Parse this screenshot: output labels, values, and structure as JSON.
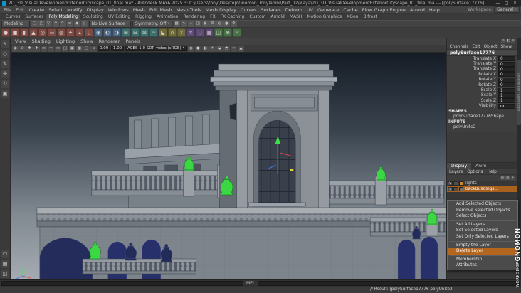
{
  "colors": {
    "manipulator_green": "#3fe04a",
    "axis_red": "#e04545",
    "axis_blue": "#4575e0",
    "handle_yellow": "#e8d43a",
    "urn_green": "#3bd843",
    "urn_navy": "#232b58",
    "selection_orange": "#a8611f"
  },
  "title_bar": {
    "title": "2D_3D_VisualDevelopmentExteriorCityscape_01_final.ma* - Autodesk MAYA 2025.3: C:\\Users\\tony\\Desktop\\Gnomon_TonyIanini\\Part_02\\Maya\\2D_3D_VisualDevelopmentExteriorCityscape_01_final.ma --- [polySurface17776]",
    "window_controls": {
      "minimize": "—",
      "maximize": "□",
      "close": "×"
    }
  },
  "menu_bar": {
    "items": [
      "File",
      "Edit",
      "Create",
      "Select",
      "Modify",
      "Display",
      "Windows",
      "Mesh",
      "Edit Mesh",
      "Mesh Tools",
      "Mesh Display",
      "Curves",
      "Surfaces",
      "Deform",
      "UV",
      "Generate",
      "Cache",
      "Flow Graph Engine",
      "Arnold",
      "Help"
    ],
    "workspace_label": "Workspace:",
    "workspace_value": "General"
  },
  "shelf": {
    "tabs": [
      {
        "label": "Curves"
      },
      {
        "label": "Surfaces"
      },
      {
        "label": "Poly Modeling",
        "active": true
      },
      {
        "label": "Sculpting"
      },
      {
        "label": "UV Editing"
      },
      {
        "label": "Rigging"
      },
      {
        "label": "Animation"
      },
      {
        "label": "Rendering"
      },
      {
        "label": "FX"
      },
      {
        "label": "FX Caching"
      },
      {
        "label": "Custom"
      },
      {
        "label": "Arnold"
      },
      {
        "label": "MASH"
      },
      {
        "label": "Motion Graphics"
      },
      {
        "label": "XGen"
      },
      {
        "label": "Bifrost"
      }
    ],
    "icons": [
      {
        "name": "poly-sphere-icon",
        "color": "#7b4a42",
        "glyph": "●"
      },
      {
        "name": "poly-cube-icon",
        "color": "#7b4a42",
        "glyph": "■"
      },
      {
        "name": "poly-cylinder-icon",
        "color": "#7b4a42",
        "glyph": "▮"
      },
      {
        "name": "poly-cone-icon",
        "color": "#7b4a42",
        "glyph": "▲"
      },
      {
        "name": "poly-torus-icon",
        "color": "#7b4a42",
        "glyph": "◎"
      },
      {
        "name": "poly-plane-icon",
        "color": "#7b4a42",
        "glyph": "▭"
      },
      {
        "name": "poly-disc-icon",
        "color": "#7b4a42",
        "glyph": "◍"
      },
      {
        "name": "poly-platonic-icon",
        "color": "#7b4a42",
        "glyph": "✦"
      },
      {
        "name": "poly-pyramid-icon",
        "color": "#7b4a42",
        "glyph": "▴"
      },
      {
        "name": "poly-pipe-icon",
        "color": "#7b4a42",
        "glyph": "▯"
      },
      {
        "name": "boolean-union-icon",
        "color": "#49627e",
        "glyph": "◉"
      },
      {
        "name": "boolean-difference-icon",
        "color": "#49627e",
        "glyph": "◐"
      },
      {
        "name": "boolean-intersect-icon",
        "color": "#49627e",
        "glyph": "◑"
      },
      {
        "name": "combine-icon",
        "color": "#3f6f6d",
        "glyph": "⊞"
      },
      {
        "name": "separate-icon",
        "color": "#3f6f6d",
        "glyph": "⊟"
      },
      {
        "name": "extract-icon",
        "color": "#3f6f6d",
        "glyph": "⊠"
      },
      {
        "name": "smooth-icon",
        "color": "#3f6f6d",
        "glyph": "≈"
      },
      {
        "name": "bevel-icon",
        "color": "#6e6a3c",
        "glyph": "◣"
      },
      {
        "name": "bridge-icon",
        "color": "#6e6a3c",
        "glyph": "∩"
      },
      {
        "name": "extrude-icon",
        "color": "#6e6a3c",
        "glyph": "⇧"
      },
      {
        "name": "multi-cut-icon",
        "color": "#5d4a73",
        "glyph": "✕"
      },
      {
        "name": "target-weld-icon",
        "color": "#5d4a73",
        "glyph": "◌"
      },
      {
        "name": "quad-draw-icon",
        "color": "#5d4a73",
        "glyph": "▦"
      },
      {
        "name": "mirror-icon",
        "color": "#4a7048",
        "glyph": "◫"
      },
      {
        "name": "merge-icon",
        "color": "#4a7048",
        "glyph": "⊕"
      },
      {
        "name": "connect-icon",
        "color": "#4a7048",
        "glyph": "≍"
      }
    ]
  },
  "status_line": {
    "menu_set": "Modeling",
    "live_surface": "No Live Surface",
    "symmetry": "Symmetry: Off",
    "icons_a": [
      {
        "name": "file-new-icon",
        "glyph": "▢"
      },
      {
        "name": "file-open-icon",
        "glyph": "◰"
      },
      {
        "name": "file-save-icon",
        "glyph": "▽"
      },
      {
        "name": "undo-icon",
        "glyph": "↶"
      },
      {
        "name": "redo-icon",
        "glyph": "↷"
      },
      {
        "name": "select-hierarchy-icon",
        "glyph": "≡"
      },
      {
        "name": "select-object-mode-icon",
        "glyph": "◆"
      },
      {
        "name": "select-component-mode-icon",
        "glyph": "◇"
      }
    ],
    "icons_b": [
      {
        "name": "snap-grid-icon",
        "glyph": "▦"
      },
      {
        "name": "snap-curve-icon",
        "glyph": "∿"
      },
      {
        "name": "snap-point-icon",
        "glyph": "∴"
      },
      {
        "name": "snap-plane-icon",
        "glyph": "◫"
      },
      {
        "name": "make-live-icon",
        "glyph": "◉"
      },
      {
        "name": "construction-history-icon",
        "glyph": "☰"
      },
      {
        "name": "render-view-icon",
        "glyph": "◐"
      },
      {
        "name": "ipr-render-icon",
        "glyph": "◑"
      },
      {
        "name": "render-settings-icon",
        "glyph": "⚙"
      }
    ]
  },
  "toolbox": {
    "tools": [
      {
        "name": "select-tool-icon",
        "glyph": "↖"
      },
      {
        "name": "lasso-tool-icon",
        "glyph": "◌"
      },
      {
        "name": "paint-select-tool-icon",
        "glyph": "✎"
      },
      {
        "name": "move-tool-icon",
        "glyph": "✛"
      },
      {
        "name": "rotate-tool-icon",
        "glyph": "↻"
      },
      {
        "name": "scale-tool-icon",
        "glyph": "▣"
      }
    ],
    "layouts": [
      {
        "name": "single-pane-layout-icon",
        "glyph": "▭"
      },
      {
        "name": "four-pane-layout-icon",
        "glyph": "▦"
      },
      {
        "name": "two-pane-layout-icon",
        "glyph": "◫"
      }
    ]
  },
  "viewport": {
    "menus": [
      "View",
      "Shading",
      "Lighting",
      "Show",
      "Renderer",
      "Panels"
    ],
    "exposure": "0.00",
    "gamma": "1.00",
    "color_space": "ACES 1.0 SDR-video (sRGB)",
    "toolbar_icons_a": [
      {
        "name": "select-camera-icon",
        "glyph": "◉"
      },
      {
        "name": "lock-camera-icon",
        "glyph": "⊘"
      },
      {
        "name": "camera-attributes-icon",
        "glyph": "✱"
      },
      {
        "name": "bookmark-icon",
        "glyph": "♦"
      },
      {
        "name": "image-plane-icon",
        "glyph": "▭"
      },
      {
        "name": "2d-pan-zoom-icon",
        "glyph": "✛"
      },
      {
        "name": "film-gate-icon",
        "glyph": "▭"
      },
      {
        "name": "resolution-gate-icon",
        "glyph": "◫"
      },
      {
        "name": "gate-mask-icon",
        "glyph": "▣"
      },
      {
        "name": "field-chart-icon",
        "glyph": "▦"
      },
      {
        "name": "safe-action-icon",
        "glyph": "◻"
      },
      {
        "name": "safe-title-icon",
        "glyph": "▫"
      }
    ],
    "toolbar_icons_b": [
      {
        "name": "wireframe-icon",
        "glyph": "◍"
      },
      {
        "name": "shaded-icon",
        "glyph": "●"
      },
      {
        "name": "textured-icon",
        "glyph": "◐"
      },
      {
        "name": "lighting-icon",
        "glyph": "☀"
      },
      {
        "name": "shadows-icon",
        "glyph": "◒"
      },
      {
        "name": "ambient-occlusion-icon",
        "glyph": "◓"
      },
      {
        "name": "motion-blur-icon",
        "glyph": "≈"
      },
      {
        "name": "antialiasing-icon",
        "glyph": "▲"
      }
    ]
  },
  "channel_box": {
    "mini_icons": [
      {
        "name": "channel-manip-off-icon",
        "glyph": "⊘"
      },
      {
        "name": "channel-manip-icon",
        "glyph": "◧"
      },
      {
        "name": "channel-stat-icon",
        "glyph": "≡"
      }
    ],
    "menus": [
      "Channels",
      "Edit",
      "Object",
      "Show"
    ],
    "object_name": "polySurface17776",
    "attributes": [
      {
        "label": "Translate X",
        "value": "0"
      },
      {
        "label": "Translate Y",
        "value": "0"
      },
      {
        "label": "Translate Z",
        "value": "0"
      },
      {
        "label": "Rotate X",
        "value": "0"
      },
      {
        "label": "Rotate Y",
        "value": "0"
      },
      {
        "label": "Rotate Z",
        "value": "0"
      },
      {
        "label": "Scale X",
        "value": "1"
      },
      {
        "label": "Scale Y",
        "value": "1"
      },
      {
        "label": "Scale Z",
        "value": "1"
      },
      {
        "label": "Visibility",
        "value": "on"
      }
    ],
    "shapes_label": "SHAPES",
    "shape_name": "polySurface17776Shape",
    "inputs_label": "INPUTS",
    "input_name": "polyUnite2"
  },
  "layer_editor": {
    "tabs": [
      {
        "label": "Display",
        "active": true
      },
      {
        "label": "Anim"
      }
    ],
    "menus": [
      "Layers",
      "Options",
      "Help"
    ],
    "icons": [
      {
        "name": "empty-layer-button-icon",
        "glyph": "▤"
      },
      {
        "name": "layer-from-selected-button-icon",
        "glyph": "▥"
      },
      {
        "name": "sort-layers-button-icon",
        "glyph": "↕"
      }
    ],
    "layers": [
      {
        "name": "lights",
        "visibility": "V",
        "color": "#cf8a2b",
        "selected": false
      },
      {
        "name": "backBuildings...",
        "visibility": "V",
        "color": "#6f6f6f",
        "selected": true
      }
    ]
  },
  "context_menu": {
    "items": [
      "Add Selected Objects",
      "Remove Selected Objects",
      "Select Objects",
      "Set All Layers",
      "Set Selected Layers",
      "Set Only Selected Layers",
      "Empty the Layer",
      "Delete Layer",
      "Membership",
      "Attributes"
    ],
    "hovered_item": "Delete Layer"
  },
  "right_dock": {
    "tab": "Channel Box / Layer Editor"
  },
  "command_line": {
    "label": "MEL",
    "result": "// Result: (polySurface17776 polyUnite2"
  },
  "watermark": {
    "line1": "GNOMON",
    "line2": "WORKSHOP"
  }
}
